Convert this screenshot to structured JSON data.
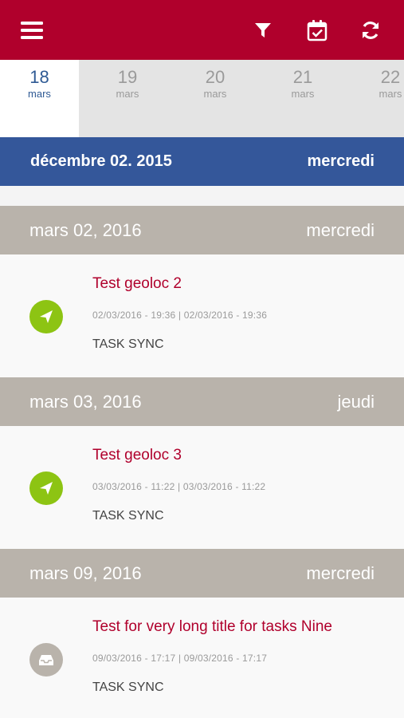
{
  "toolbar": {
    "menu_icon": "hamburger-menu-icon",
    "filter_icon": "filter-icon",
    "calendar_icon": "calendar-check-icon",
    "refresh_icon": "refresh-icon",
    "brand_color": "#b0002c"
  },
  "date_strip": {
    "days": [
      {
        "num": "18",
        "month": "mars",
        "selected": true
      },
      {
        "num": "19",
        "month": "mars",
        "selected": false
      },
      {
        "num": "20",
        "month": "mars",
        "selected": false
      },
      {
        "num": "21",
        "month": "mars",
        "selected": false
      },
      {
        "num": "22",
        "month": "mars",
        "selected": false
      }
    ]
  },
  "sections": [
    {
      "date": "décembre 02. 2015",
      "weekday": "mercredi",
      "style": "highlight"
    },
    {
      "date": "mars 02, 2016",
      "weekday": "mercredi"
    },
    {
      "date": "mars 03, 2016",
      "weekday": "jeudi"
    },
    {
      "date": "mars 09, 2016",
      "weekday": "mercredi"
    }
  ],
  "tasks": [
    {
      "title": "Test geoloc 2",
      "dates": "02/03/2016 - 19:36 | 02/03/2016 - 19:36",
      "status": "TASK SYNC",
      "icon": "paper-plane-icon",
      "icon_color": "#8dc413"
    },
    {
      "title": "Test geoloc 3",
      "dates": "03/03/2016 - 11:22 | 03/03/2016 - 11:22",
      "status": "TASK SYNC",
      "icon": "paper-plane-icon",
      "icon_color": "#8dc413"
    },
    {
      "title": "Test for very long title for tasks Nine",
      "dates": "09/03/2016 - 17:17 | 09/03/2016 - 17:17",
      "status": "TASK SYNC",
      "icon": "inbox-icon",
      "icon_color": "#b9b3ab"
    }
  ]
}
